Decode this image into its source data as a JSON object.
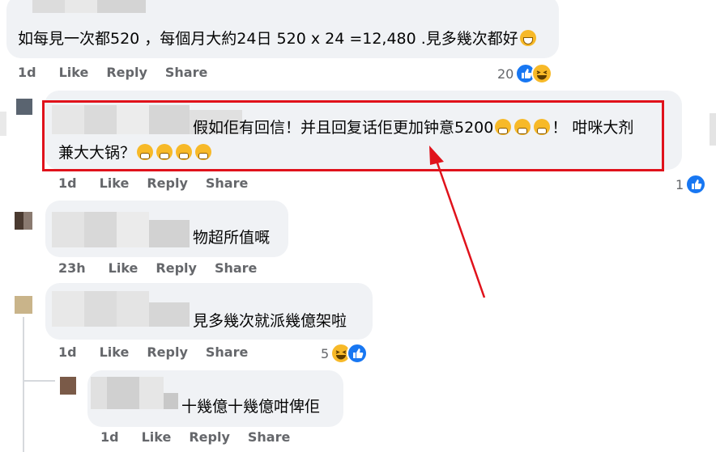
{
  "comments": [
    {
      "text": "如每見一次都520 ，每個月大約24日 520 x 24 =12,480 .見多幾次都好",
      "time": "1d",
      "like": "Like",
      "reply": "Reply",
      "share": "Share",
      "reaction_count": "20"
    },
    {
      "text_line1": "假如佢有回信！并且回复话佢更加钟意5200",
      "text_line1_tail": "！ 咁咪大剂",
      "text_line2": "兼大大锅？",
      "time": "1d",
      "like": "Like",
      "reply": "Reply",
      "share": "Share",
      "reaction_count": "1"
    },
    {
      "text": "物超所值嘅",
      "time": "23h",
      "like": "Like",
      "reply": "Reply",
      "share": "Share"
    },
    {
      "text": "見多幾次就派幾億架啦",
      "time": "1d",
      "like": "Like",
      "reply": "Reply",
      "share": "Share",
      "reaction_count": "5"
    },
    {
      "text": "十幾億十幾億咁俾佢",
      "time": "1d",
      "like": "Like",
      "reply": "Reply",
      "share": "Share"
    }
  ],
  "icons": {
    "like": "like-reaction-icon",
    "haha": "haha-reaction-icon",
    "grin": "grinning-emoji-icon",
    "hush": "face-with-hand-over-mouth-emoji-icon"
  },
  "colors": {
    "bubble": "#f0f2f5",
    "meta_text": "#65676b",
    "like_blue": "#1877f2",
    "highlight_red": "#e0121b"
  }
}
